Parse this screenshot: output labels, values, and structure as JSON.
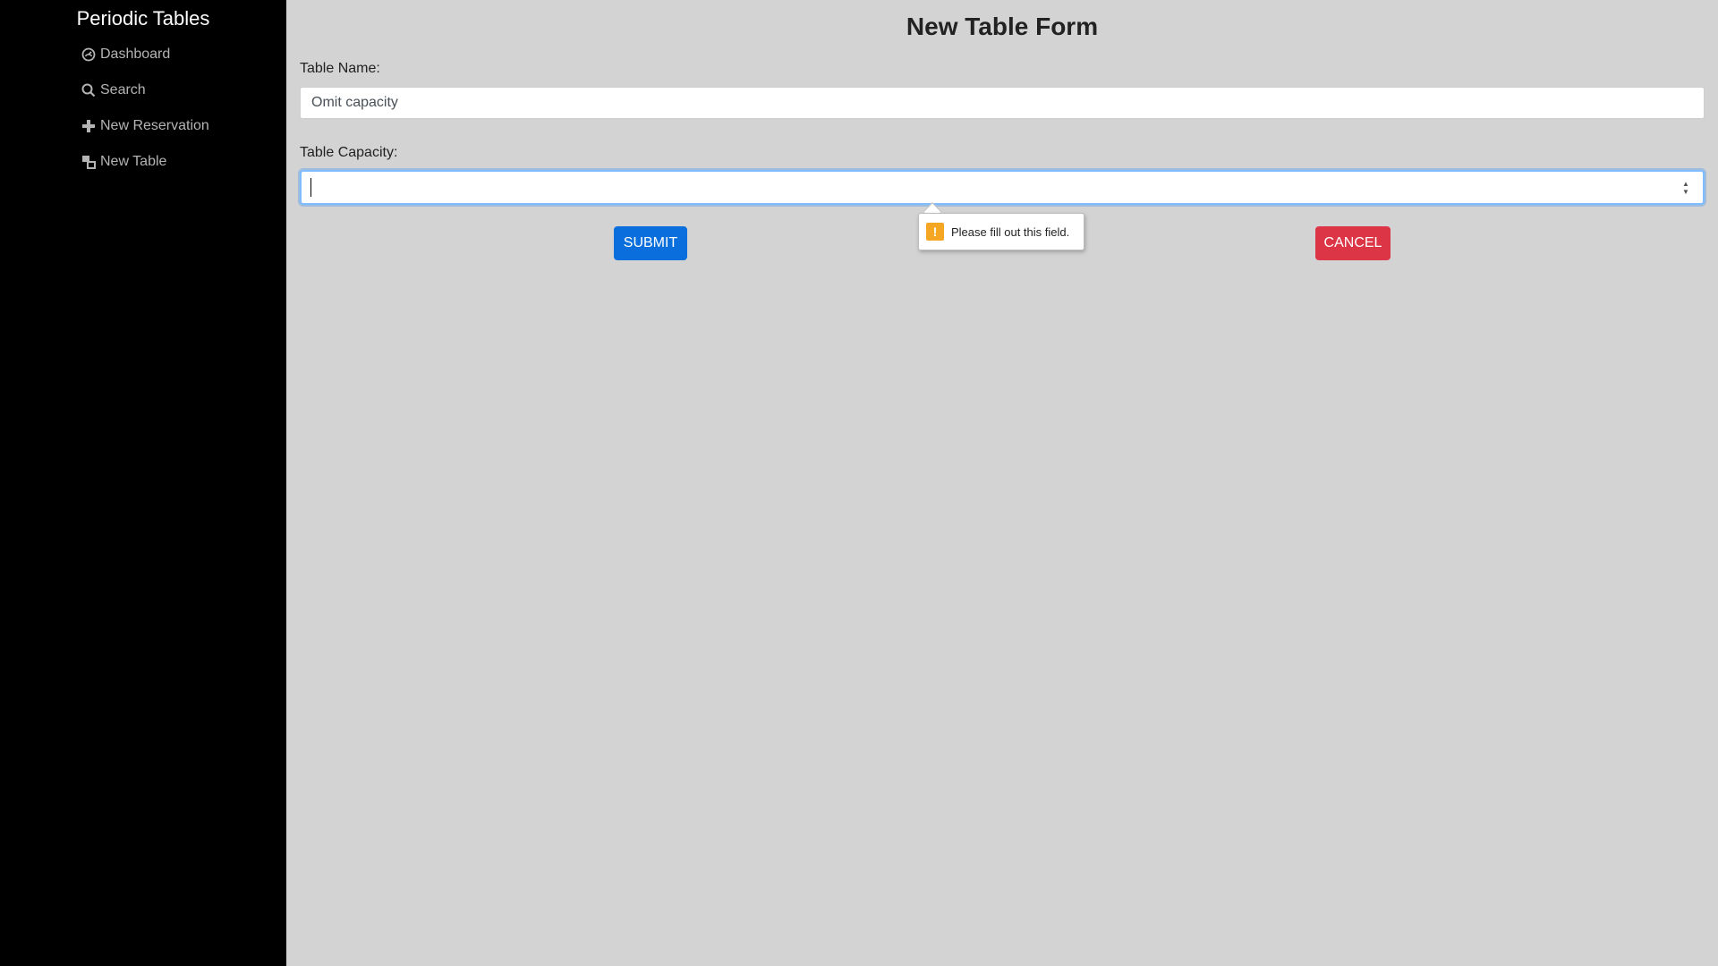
{
  "sidebar": {
    "brand": "Periodic Tables",
    "items": [
      {
        "label": "Dashboard",
        "icon": "dashboard-icon"
      },
      {
        "label": "Search",
        "icon": "search-icon"
      },
      {
        "label": "New Reservation",
        "icon": "plus-icon"
      },
      {
        "label": "New Table",
        "icon": "table-icon"
      }
    ]
  },
  "main": {
    "title": "New Table Form",
    "form": {
      "table_name_label": "Table Name:",
      "table_name_value": "Omit capacity",
      "table_capacity_label": "Table Capacity:",
      "table_capacity_value": ""
    },
    "buttons": {
      "submit": "SUBMIT",
      "cancel": "CANCEL"
    },
    "validation": {
      "message": "Please fill out this field.",
      "icon": "warning-icon",
      "icon_glyph": "!"
    }
  },
  "colors": {
    "sidebar_bg": "#000000",
    "main_bg": "#d3d3d3",
    "submit": "#0a6fdc",
    "cancel": "#dc3545",
    "warning": "#f5a623"
  }
}
